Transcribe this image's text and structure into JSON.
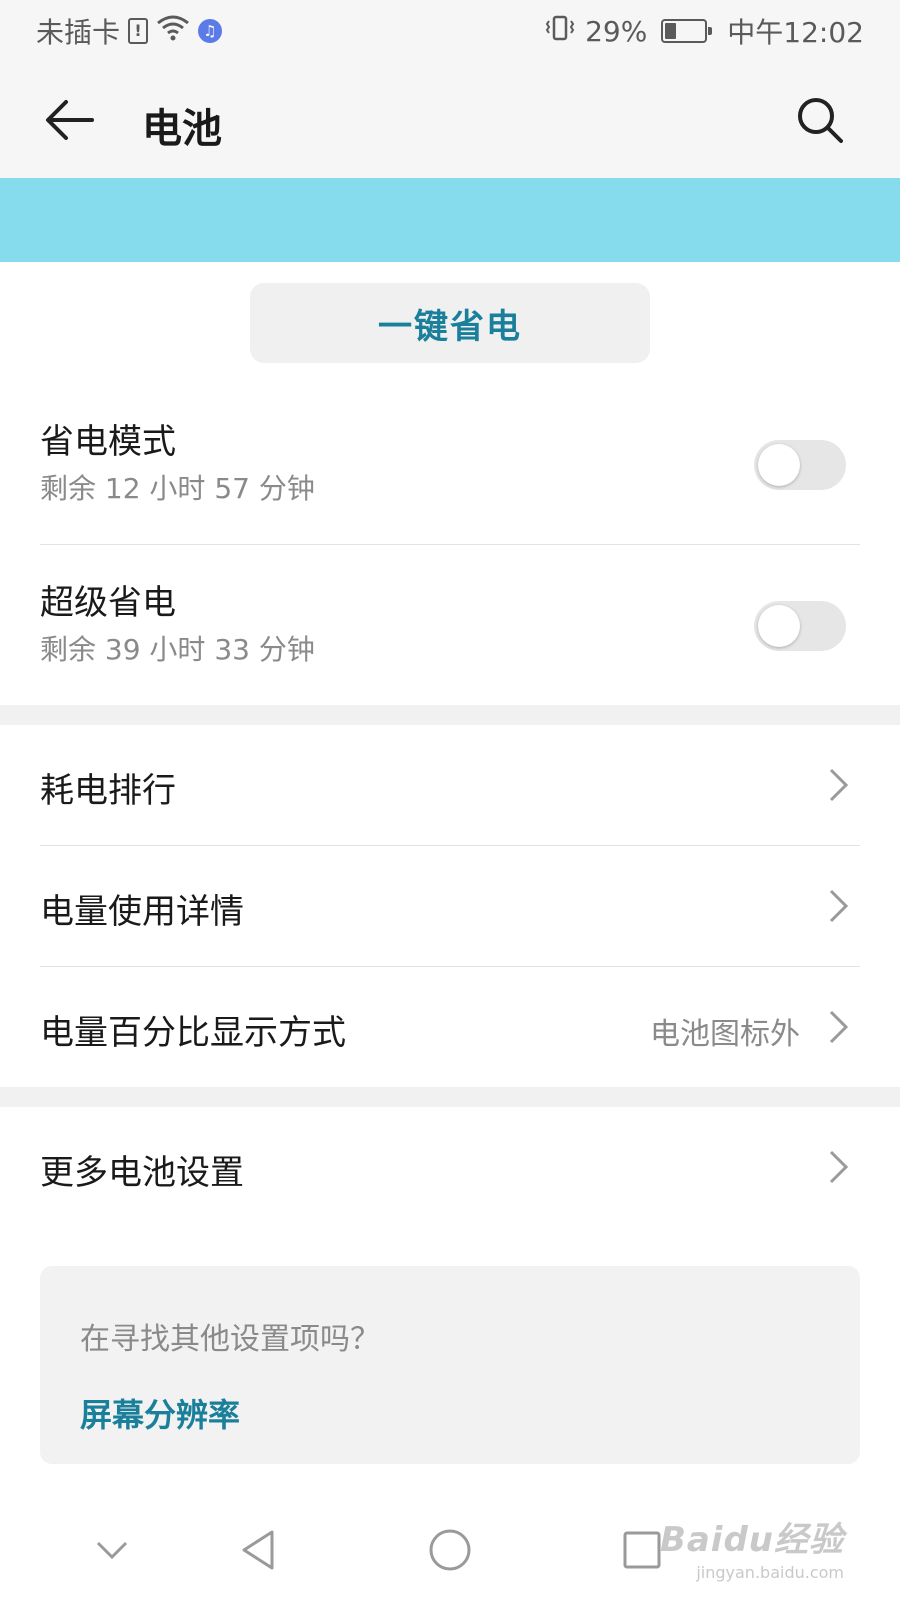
{
  "status_bar": {
    "carrier": "未插卡",
    "sim_icon_text": "!",
    "battery_percent": "29%",
    "battery_level": 0.29,
    "time": "中午12:02",
    "icons": [
      "sim-alert-icon",
      "wifi-icon",
      "music-icon",
      "vibrate-icon",
      "battery-icon"
    ]
  },
  "app_bar": {
    "title": "电池",
    "back_icon": "back-arrow-icon",
    "search_icon": "search-icon"
  },
  "colors": {
    "banner": "#86dbed",
    "accent": "#1a7f9a",
    "switch_off": "#e6e6e6"
  },
  "one_key_button": {
    "label": "一键省电"
  },
  "power_modes": [
    {
      "title": "省电模式",
      "subtitle": "剩余 12 小时 57 分钟",
      "enabled": false
    },
    {
      "title": "超级省电",
      "subtitle": "剩余 39 小时 33 分钟",
      "enabled": false
    }
  ],
  "menu": [
    {
      "label": "耗电排行",
      "value": ""
    },
    {
      "label": "电量使用详情",
      "value": ""
    },
    {
      "label": "电量百分比显示方式",
      "value": "电池图标外"
    },
    {
      "label": "更多电池设置",
      "value": ""
    }
  ],
  "suggestion": {
    "question": "在寻找其他设置项吗？",
    "link": "屏幕分辨率"
  },
  "nav_bar": {
    "buttons": [
      "hide-nav-icon",
      "back-triangle-icon",
      "home-circle-icon",
      "recents-square-icon"
    ]
  },
  "watermark": {
    "logo": "Baidu经验",
    "url": "jingyan.baidu.com"
  }
}
